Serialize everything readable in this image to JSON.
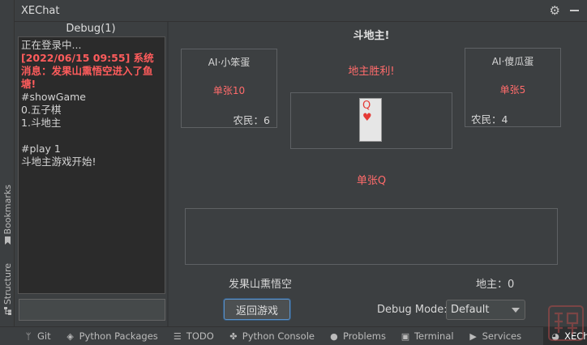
{
  "window": {
    "title": "XEChat"
  },
  "side_tabs": {
    "bookmarks": "Bookmarks",
    "structure": "Structure"
  },
  "debug": {
    "header": "Debug(1)",
    "log": [
      {
        "text": "正在登录中...",
        "style": "normal"
      },
      {
        "text": "[2022/06/15 09:55] 系统消息：发果山熏悟空进入了鱼塘!",
        "style": "red"
      },
      {
        "text": "#showGame",
        "style": "normal"
      },
      {
        "text": "0.五子棋",
        "style": "normal"
      },
      {
        "text": "1.斗地主",
        "style": "normal"
      },
      {
        "text": " ",
        "style": "normal"
      },
      {
        "text": "#play 1",
        "style": "normal"
      },
      {
        "text": "斗地主游戏开始!",
        "style": "normal"
      }
    ],
    "input_value": ""
  },
  "game": {
    "title": "斗地主!",
    "left_player": {
      "name": "AI·小笨蛋",
      "cards": "单张10",
      "role": "农民：6"
    },
    "right_player": {
      "name": "AI·傻瓜蛋",
      "cards": "单张5",
      "role": "农民：4"
    },
    "winner_text": "地主胜利!",
    "played_card": {
      "rank": "Q",
      "suit": "♥"
    },
    "last_play": "单张Q",
    "my_name": "发果山熏悟空",
    "landlord_count": "地主：0",
    "back_button": "返回游戏",
    "debug_mode_label": "Debug Mode:",
    "debug_mode_value": "Default"
  },
  "bottom_tabs": [
    {
      "label": "Git",
      "icon": "git-branch-icon"
    },
    {
      "label": "Python Packages",
      "icon": "layers-icon"
    },
    {
      "label": "TODO",
      "icon": "list-icon"
    },
    {
      "label": "Python Console",
      "icon": "python-icon"
    },
    {
      "label": "Problems",
      "icon": "info-icon"
    },
    {
      "label": "Terminal",
      "icon": "terminal-icon"
    },
    {
      "label": "Services",
      "icon": "play-icon"
    },
    {
      "label": "XEChat",
      "icon": "chat-icon"
    }
  ],
  "colors": {
    "accent_red": "#ff6b6b",
    "focus_blue": "#5c92c9",
    "background": "#3c3f41"
  }
}
